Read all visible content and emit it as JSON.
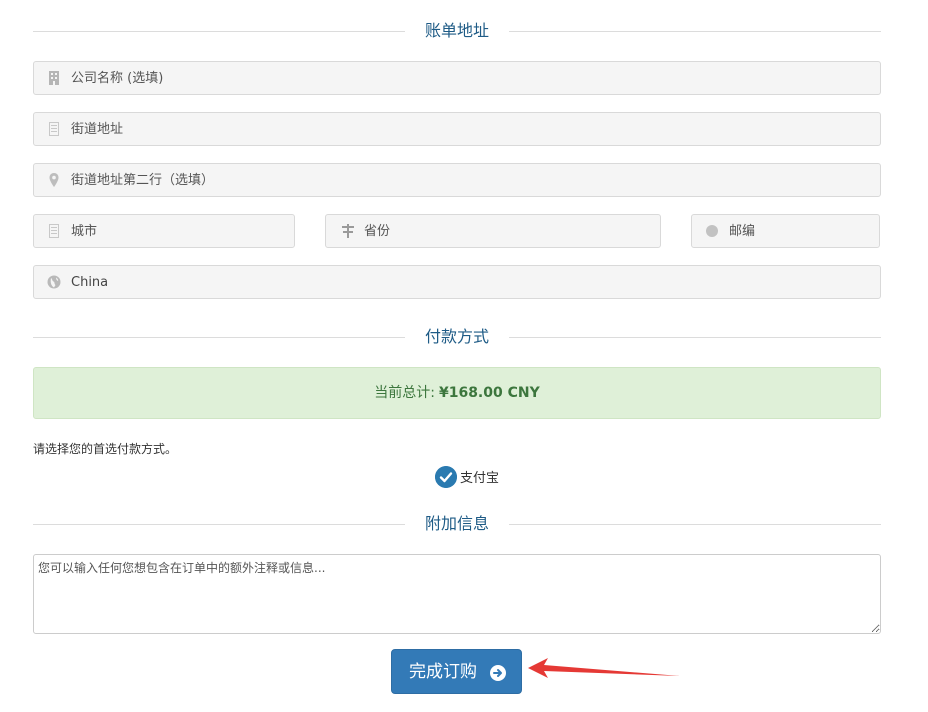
{
  "billing": {
    "heading": "账单地址",
    "company_placeholder": "公司名称 (选填)",
    "street_placeholder": "街道地址",
    "street2_placeholder": "街道地址第二行（选填）",
    "city_placeholder": "城市",
    "state_placeholder": "省份",
    "postcode_placeholder": "邮编",
    "country_value": "China"
  },
  "payment": {
    "heading": "付款方式",
    "total_label": "当前总计:",
    "total_amount": "¥168.00 CNY",
    "prompt": "请选择您的首选付款方式。",
    "option_label": "支付宝"
  },
  "additional": {
    "heading": "附加信息",
    "notes_placeholder": "您可以输入任何您想包含在订单中的额外注释或信息..."
  },
  "submit": {
    "label": "完成订购"
  },
  "colors": {
    "heading": "#1e5b86",
    "button": "#337ab7",
    "alert_bg": "#dff0d8",
    "alert_text": "#3c763d",
    "annotation_arrow": "#e53935"
  },
  "icons": {
    "company": "building-icon",
    "street": "building-icon",
    "street2": "map-marker-icon",
    "city": "building-icon",
    "state": "chinese-character-icon",
    "postcode": "circle-icon",
    "country": "globe-icon",
    "payment_selected": "check-circle-icon",
    "submit": "arrow-circle-right-icon"
  }
}
